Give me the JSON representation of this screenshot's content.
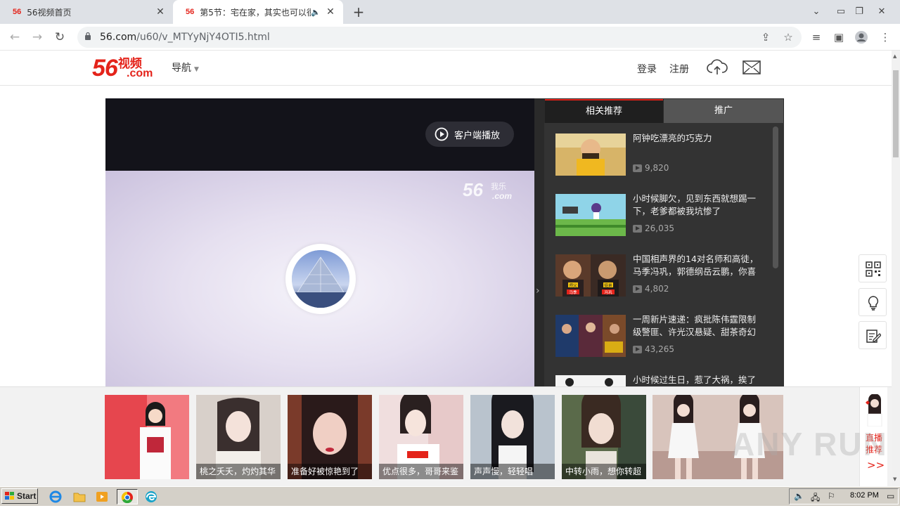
{
  "browser": {
    "tabs": [
      {
        "favicon": "56",
        "title": "56视频首页"
      },
      {
        "favicon": "56",
        "title": "第5节：宅在家，其实也可以很"
      }
    ],
    "new_tab": "+",
    "address": {
      "host": "56.com",
      "path": "/u60/v_MTYyNjY4OTI5.html"
    }
  },
  "header": {
    "logo_num": "56",
    "logo_cn": "视频",
    "logo_com": ".com",
    "nav_label": "导航",
    "login": "登录",
    "register": "注册"
  },
  "player": {
    "client_play": "客户端播放",
    "watermark": {
      "num": "56",
      "sub": "我乐",
      "com": ".com"
    }
  },
  "sidebar": {
    "tab_related": "相关推荐",
    "tab_promo": "推广",
    "items": [
      {
        "title": "阿钟吃漂亮的巧克力",
        "views": "9,820"
      },
      {
        "title": "小时候脚欠，见到东西就想踢一下，老爹都被我坑惨了",
        "views": "26,035"
      },
      {
        "title": "中国相声界的14对名师和高徒，马季冯巩，郭德纲岳云鹏，你喜欢谁",
        "views": "4,802"
      },
      {
        "title": "一周新片速递：疯批陈伟霆限制级警匪、许光汉悬疑、甜茶奇幻登陆",
        "views": "43,265"
      },
      {
        "title": "小时候过生日，惹了大祸，挨了毒",
        "views": ""
      }
    ],
    "thumb3_labels": [
      "师父",
      "马季",
      "徒弟",
      "冯巩"
    ]
  },
  "bottom": {
    "live": [
      {
        "caption": "桃之夭夭，灼灼其华"
      },
      {
        "caption": "准备好被惊艳到了"
      },
      {
        "caption": "优点很多，哥哥来鉴"
      },
      {
        "caption": "声声慢，轻轻唱"
      },
      {
        "caption": "中转小雨，想你转超"
      },
      {
        "caption": ""
      }
    ],
    "live_rec": "直播推荐",
    "chevron": ">>"
  },
  "taskbar": {
    "start": "Start",
    "clock": "8:02 PM"
  },
  "watermark_text": "ANY RUN",
  "colors": {
    "brand": "#e4231a",
    "player_bg": "#13131a",
    "sidebar_bg": "#333333"
  }
}
